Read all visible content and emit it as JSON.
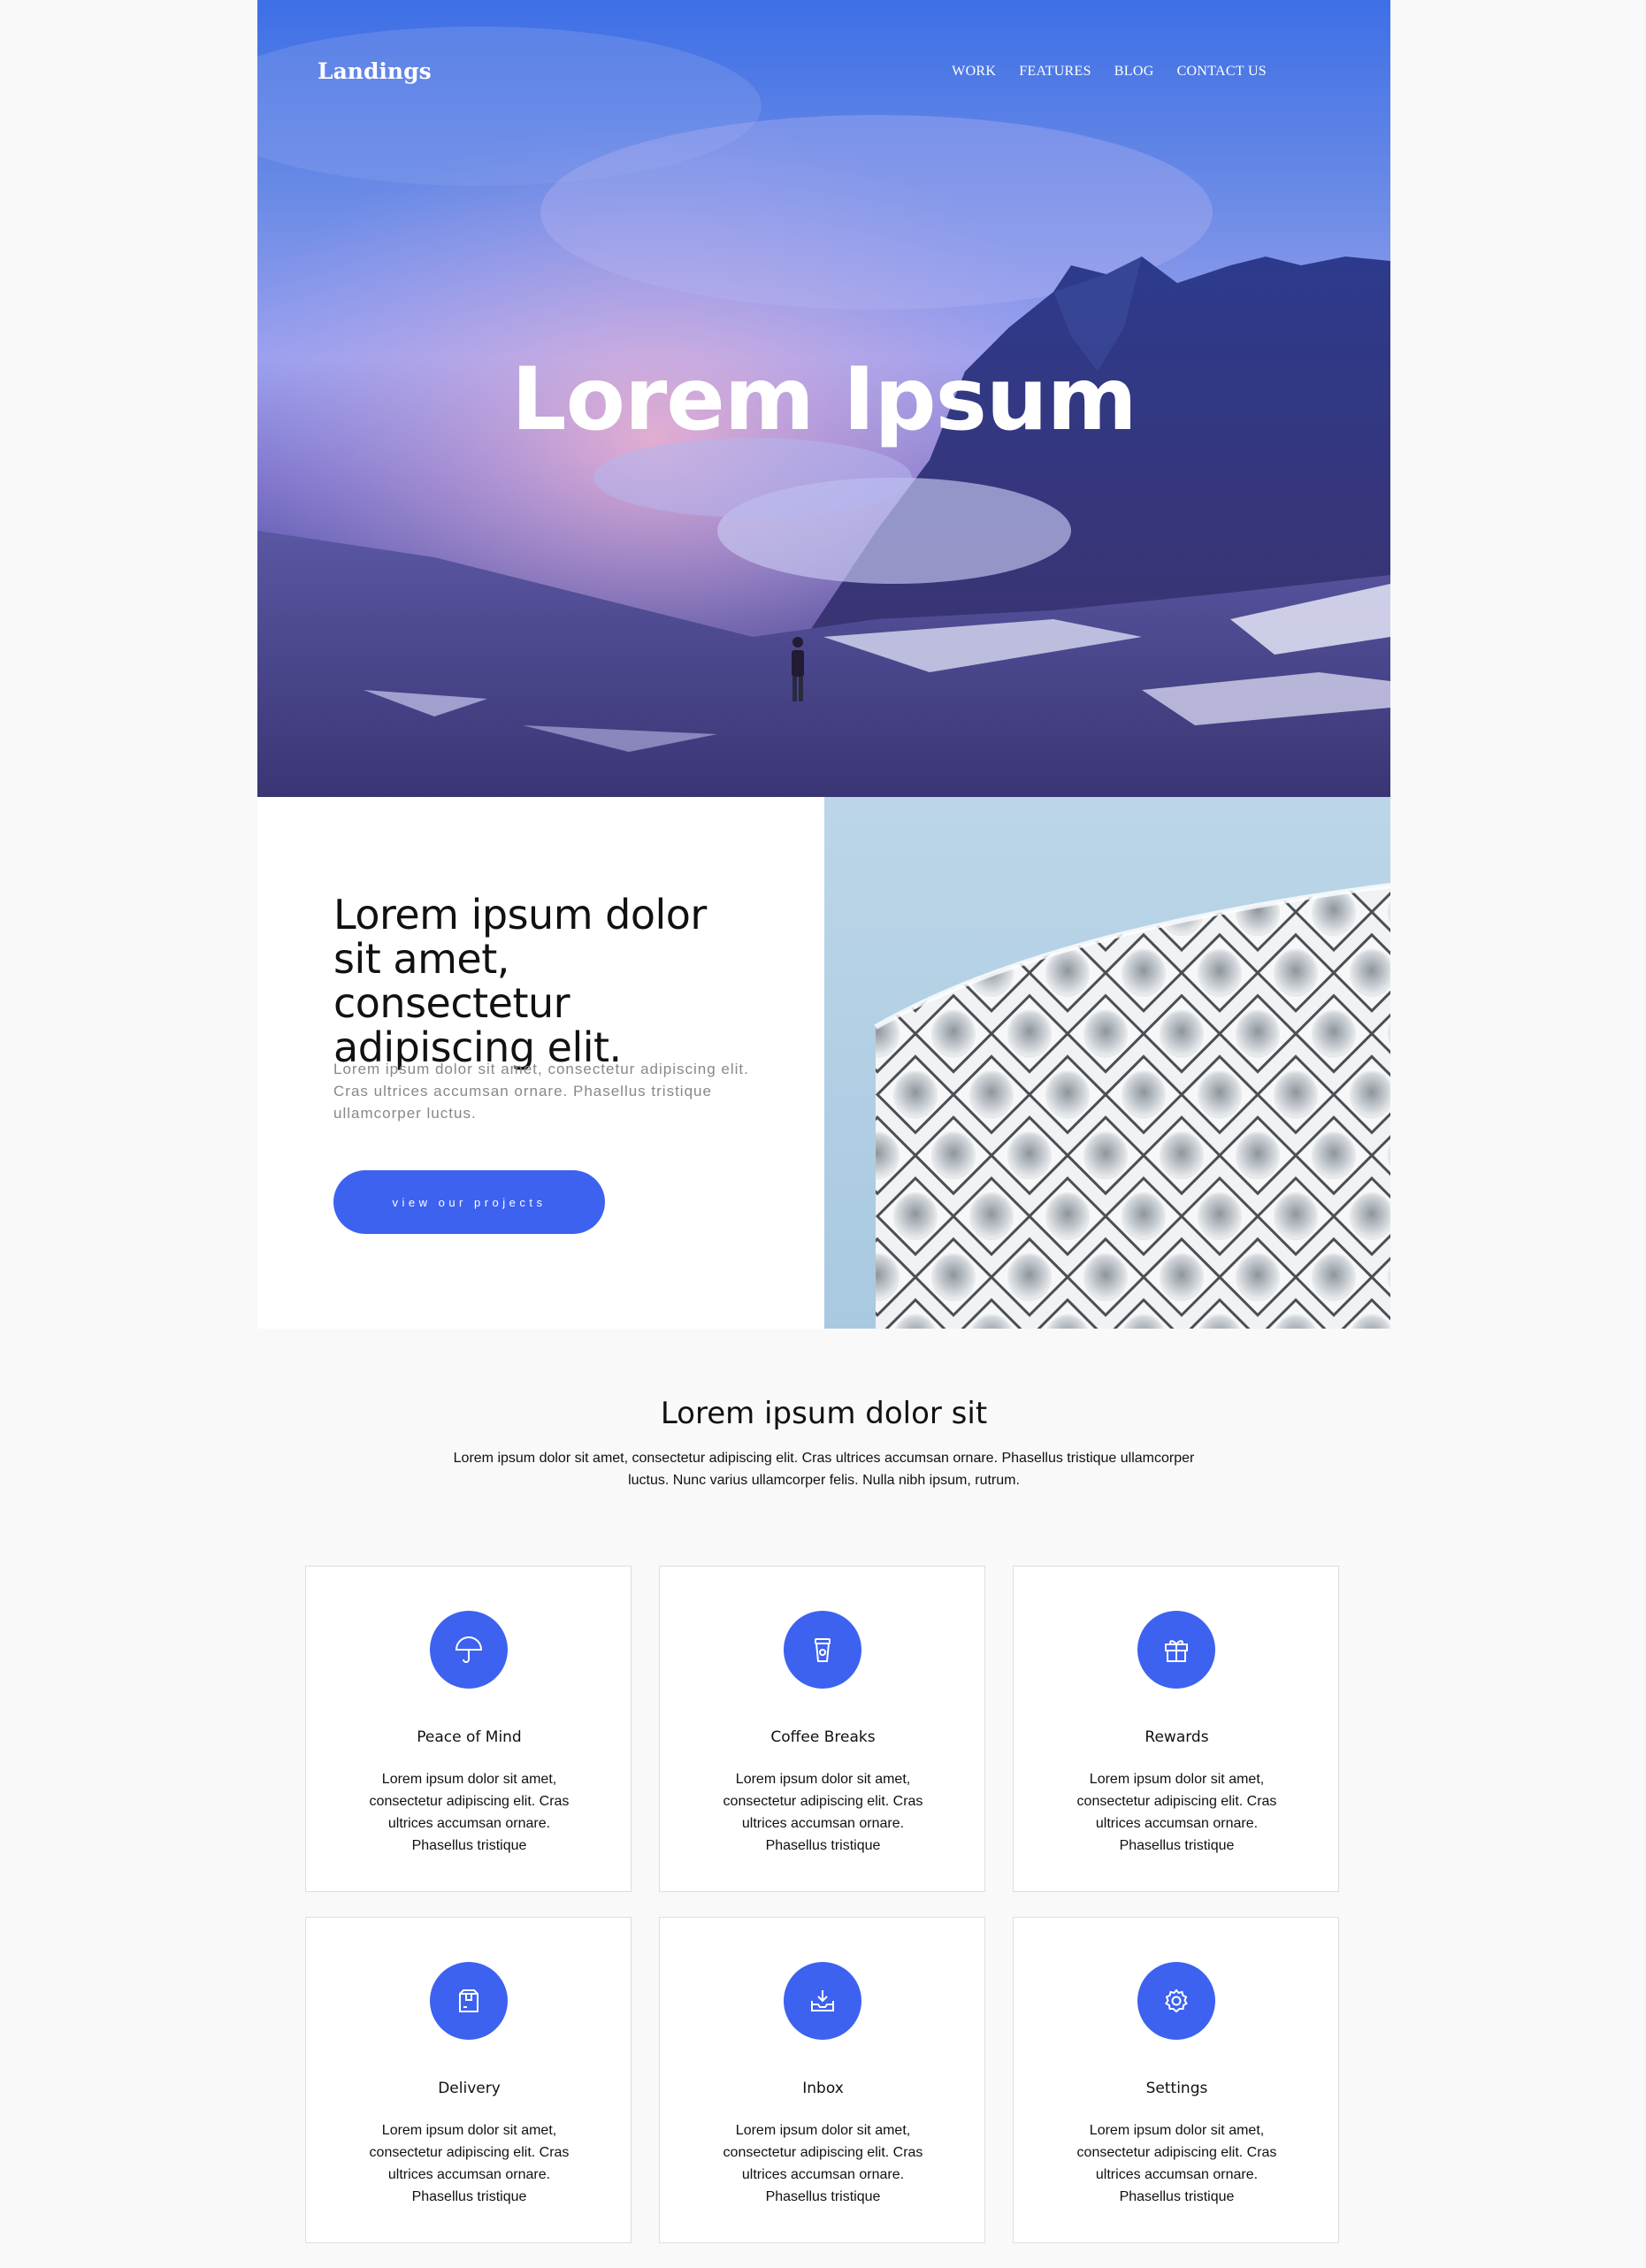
{
  "header": {
    "brand": "Landings",
    "nav": [
      "WORK",
      "FEATURES",
      "BLOG",
      "CONTACT US"
    ]
  },
  "hero": {
    "title": "Lorem Ipsum"
  },
  "split": {
    "heading": "Lorem ipsum dolor sit amet, consectetur adipiscing elit.",
    "text": "Lorem ipsum dolor sit amet, consectetur adipiscing elit. Cras ultrices accumsan ornare. Phasellus tristique ullamcorper luctus.",
    "button": "view our projects"
  },
  "features": {
    "title": "Lorem ipsum dolor sit",
    "subtitle": "Lorem ipsum dolor sit amet, consectetur adipiscing elit. Cras ultrices accumsan ornare. Phasellus tristique ullamcorper luctus. Nunc varius ullamcorper felis. Nulla nibh ipsum, rutrum.",
    "cards": [
      {
        "title": "Peace of Mind",
        "icon": "umbrella-icon",
        "text": "Lorem ipsum dolor sit amet, consectetur adipiscing elit. Cras ultrices accumsan ornare. Phasellus tristique"
      },
      {
        "title": "Coffee Breaks",
        "icon": "coffee-cup-icon",
        "text": "Lorem ipsum dolor sit amet, consectetur adipiscing elit. Cras ultrices accumsan ornare. Phasellus tristique"
      },
      {
        "title": "Rewards",
        "icon": "gift-icon",
        "text": "Lorem ipsum dolor sit amet, consectetur adipiscing elit. Cras ultrices accumsan ornare. Phasellus tristique"
      },
      {
        "title": "Delivery",
        "icon": "box-icon",
        "text": "Lorem ipsum dolor sit amet, consectetur adipiscing elit. Cras ultrices accumsan ornare. Phasellus tristique"
      },
      {
        "title": "Inbox",
        "icon": "inbox-icon",
        "text": "Lorem ipsum dolor sit amet, consectetur adipiscing elit. Cras ultrices accumsan ornare. Phasellus tristique"
      },
      {
        "title": "Settings",
        "icon": "gear-icon",
        "text": "Lorem ipsum dolor sit amet, consectetur adipiscing elit. Cras ultrices accumsan ornare. Phasellus tristique"
      }
    ]
  },
  "colors": {
    "accent": "#3d62f0"
  }
}
